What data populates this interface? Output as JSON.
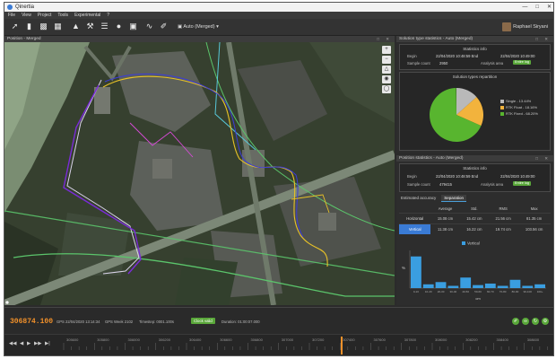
{
  "window": {
    "title": "Qinertia"
  },
  "menu": [
    "File",
    "View",
    "Project",
    "Tools",
    "Experimental",
    "?"
  ],
  "toolbar": {
    "combo": "Auto (Merged)",
    "user": "Raphael Siryani"
  },
  "map_panel": {
    "title": "Position - Merged"
  },
  "solution_panel": {
    "title": "Solution type statistics - Auto (Merged)",
    "info_title": "Statistics info",
    "begin_label": "Begin",
    "begin_value": "22/04/2020 10:48:59 End",
    "end_value": "22/04/2020 10:49:00",
    "count_label": "Sample count",
    "count_value": "2950",
    "area_label": "Analysis area",
    "area_button": "Entire log",
    "sep_title": "Solution types repartition",
    "legend": [
      {
        "label": "Single - 13.44%",
        "color": "#b9b9b9"
      },
      {
        "label": "RTK Float - 18.16%",
        "color": "#f2b33d"
      },
      {
        "label": "RTK Fixed - 68.20%",
        "color": "#58b52f"
      }
    ]
  },
  "position_panel": {
    "title": "Position statistics - Auto (Merged)",
    "info_title": "Statistics info",
    "begin_label": "Begin",
    "begin_value": "22/04/2020 10:48:59 End",
    "end_value": "22/04/2020 10:49:00",
    "count_label": "Sample count",
    "count_value": "479415",
    "area_label": "Analysis area",
    "area_button": "Entire log",
    "tabs": [
      "Estimated accuracy",
      "Separation"
    ],
    "headers": [
      "",
      "Average",
      "Std.",
      "RMS",
      "Max"
    ],
    "rows": [
      {
        "label": "Horizontal",
        "values": [
          "15.08 cm",
          "15.42 cm",
          "21.56 cm",
          "81.35 cm"
        ]
      },
      {
        "label": "Vertical",
        "values": [
          "11.38 cm",
          "16.22 cm",
          "19.74 cm",
          "103.56 cm"
        ]
      }
    ],
    "hist_legend": "Vertical",
    "hist_ylabel": "%",
    "hist_xlabel": "cm",
    "hist_categories": [
      "0-10",
      "10-20",
      "20-30",
      "30-40",
      "40-50",
      "50-60",
      "60-70",
      "70-80",
      "80-90",
      "90-100",
      "100+"
    ],
    "hist_values": [
      42,
      5,
      8,
      3,
      14,
      4,
      6,
      3,
      11,
      3,
      5
    ],
    "hist_color": "#3a9ee0"
  },
  "statusbar": {
    "time": "306874.100",
    "gps": "GPS 22/04/2020 13:14:34",
    "week": "GPS Week 2102",
    "timestep": "Timestep: 0001.100s",
    "fix": "Clock valid",
    "duration": "Duration: 01:00:07.000"
  },
  "timeline": {
    "ticks": [
      "305600",
      "305800",
      "306000",
      "306200",
      "306400",
      "306600",
      "306800",
      "307000",
      "307200",
      "307400",
      "307600",
      "307800",
      "308000",
      "308200",
      "308400",
      "308600"
    ]
  }
}
